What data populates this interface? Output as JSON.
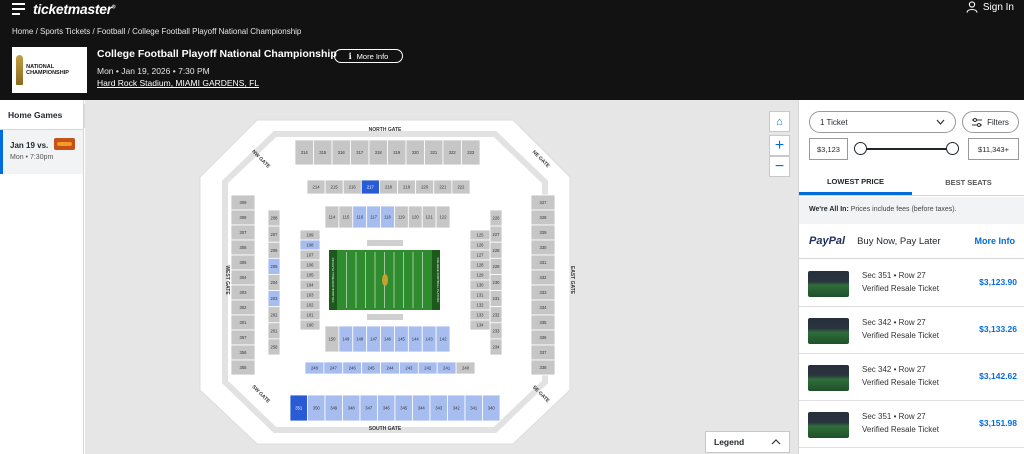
{
  "header": {
    "logo": "ticketmaster",
    "logo_mark": "®",
    "signin": "Sign In",
    "breadcrumb": [
      "Home",
      "Sports Tickets",
      "Football",
      "College Football Playoff National Championship"
    ],
    "event_logo_text": "NATIONAL CHAMPIONSHIP",
    "title": "College Football Playoff National Championship",
    "more_info": "More Info",
    "date": "Mon • Jan 19, 2026 • 7:30 PM",
    "venue": "Hard Rock Stadium, MIAMI GARDENS, FL"
  },
  "sidebar": {
    "heading": "Home Games",
    "games": [
      {
        "date": "Jan 19 vs.",
        "time": "Mon • 7:30pm"
      }
    ]
  },
  "map": {
    "gates": {
      "north": "NORTH GATE",
      "south": "SOUTH GATE",
      "east": "EAST GATE",
      "west": "WEST GATE",
      "ne": "NE GATE",
      "nw": "NW GATE",
      "se": "SE GATE",
      "sw": "SW GATE"
    },
    "field_text_left": "COLLEGE FOOTBALL PLAYOFF",
    "field_text_right": "COLLEGE FOOTBALL PLAYOFF",
    "top_300": [
      "314",
      "315",
      "316",
      "317",
      "318",
      "319",
      "320",
      "321",
      "322",
      "323"
    ],
    "top_200": [
      "214",
      "215",
      "216",
      "217",
      "218",
      "219",
      "220",
      "221",
      "222"
    ],
    "top_100": [
      "114",
      "115",
      "116",
      "117",
      "118",
      "119",
      "120",
      "121",
      "122"
    ],
    "bottom_300": [
      "351",
      "350",
      "349",
      "348",
      "347",
      "346",
      "345",
      "344",
      "343",
      "342",
      "341",
      "340"
    ],
    "bottom_200": [
      "248",
      "247",
      "246",
      "245",
      "244",
      "243",
      "242",
      "241",
      "240"
    ],
    "bottom_100": [
      "150",
      "149",
      "148",
      "147",
      "146",
      "145",
      "144",
      "143",
      "142"
    ],
    "west_300": [
      "309",
      "308",
      "307",
      "306",
      "305",
      "304",
      "303",
      "302",
      "301",
      "357",
      "356",
      "355"
    ],
    "west_200": [
      "208",
      "207",
      "206",
      "205",
      "204",
      "203",
      "202",
      "201",
      "258"
    ],
    "west_100": [
      "109",
      "108",
      "107",
      "106",
      "105",
      "104",
      "103",
      "102",
      "101",
      "160"
    ],
    "east_300": [
      "327",
      "328",
      "329",
      "330",
      "331",
      "332",
      "333",
      "334",
      "335",
      "336",
      "337",
      "338"
    ],
    "east_200": [
      "226",
      "227",
      "228",
      "229",
      "230",
      "231",
      "232",
      "233",
      "234"
    ],
    "east_100": [
      "125",
      "126",
      "127",
      "128",
      "129",
      "130",
      "131",
      "132",
      "133",
      "134"
    ],
    "highlight_dark": [
      "217",
      "351",
      "153",
      "154",
      "138",
      "139"
    ],
    "highlight_light": [
      "116",
      "117",
      "118",
      "203",
      "205",
      "350",
      "349",
      "348",
      "347",
      "346",
      "345",
      "344",
      "343",
      "342",
      "341",
      "340",
      "248",
      "247",
      "246",
      "245",
      "244",
      "243",
      "242",
      "241",
      "149",
      "148",
      "147",
      "146",
      "145",
      "144",
      "143",
      "142",
      "152",
      "141",
      "136",
      "108"
    ],
    "legend": "Legend"
  },
  "panel": {
    "quantity": "1 Ticket",
    "filters": "Filters",
    "price_min": "$3,123",
    "price_max": "$11,343+",
    "slider_min_fraction": 0,
    "slider_max_fraction": 1,
    "tabs": [
      "LOWEST PRICE",
      "BEST SEATS"
    ],
    "allin_bold": "We're All In:",
    "allin_text": " Prices include fees (before taxes).",
    "paypal_logo_a": "Pay",
    "paypal_logo_b": "Pal",
    "paypal_text": "Buy Now, Pay Later",
    "paypal_link": "More Info",
    "listings": [
      {
        "section": "Sec 351 • Row 27",
        "type": "Verified Resale Ticket",
        "price": "$3,123.90"
      },
      {
        "section": "Sec 342 • Row 27",
        "type": "Verified Resale Ticket",
        "price": "$3,133.26"
      },
      {
        "section": "Sec 342 • Row 27",
        "type": "Verified Resale Ticket",
        "price": "$3,142.62"
      },
      {
        "section": "Sec 351 • Row 27",
        "type": "Verified Resale Ticket",
        "price": "$3,151.98"
      }
    ]
  },
  "colors": {
    "accent": "#026cdf",
    "dark": "#121212",
    "section_gray": "#c6c6c6",
    "section_light_blue": "#a7bdf0",
    "section_dark_blue": "#2a5bd7",
    "field": "#2e8b2e"
  }
}
